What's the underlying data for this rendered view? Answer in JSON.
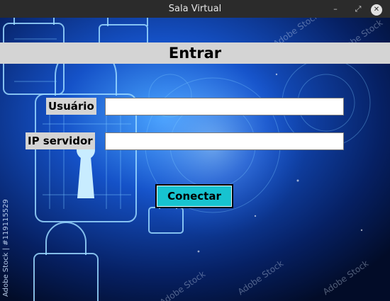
{
  "window": {
    "title": "Sala Virtual",
    "minimize_glyph": "–",
    "maximize_glyph": "⤢",
    "close_glyph": "✕"
  },
  "form": {
    "heading": "Entrar",
    "user_label": "Usuário",
    "user_value": "",
    "ip_label": "IP servidor",
    "ip_value": "",
    "connect_label": "Conectar"
  },
  "background": {
    "credit_text": "Adobe Stock | #119115529",
    "watermark_text": "Adobe Stock"
  },
  "colors": {
    "button_bg": "#17c3d0",
    "band_bg": "#d4d4d4",
    "bg_deep": "#02102e",
    "bg_glow": "#2f8cff"
  }
}
